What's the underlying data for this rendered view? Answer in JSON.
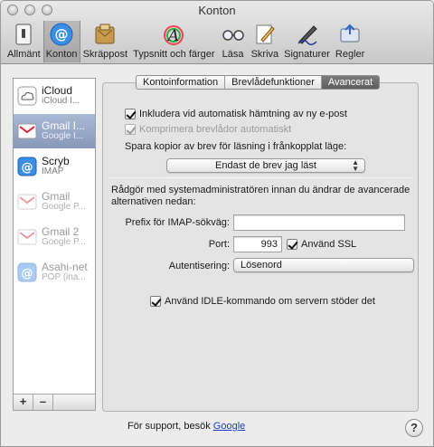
{
  "window": {
    "title": "Konton"
  },
  "toolbar": [
    {
      "label": "Allmänt",
      "icon": "switch-icon"
    },
    {
      "label": "Konton",
      "icon": "at-sign-icon",
      "selected": true
    },
    {
      "label": "Skräppost",
      "icon": "junk-mail-icon"
    },
    {
      "label": "Typsnitt och färger",
      "icon": "fonts-colors-icon"
    },
    {
      "label": "Läsa",
      "icon": "glasses-icon"
    },
    {
      "label": "Skriva",
      "icon": "pencil-icon"
    },
    {
      "label": "Signaturer",
      "icon": "signature-pen-icon"
    },
    {
      "label": "Regler",
      "icon": "rules-icon"
    }
  ],
  "accounts": [
    {
      "name": "iCloud",
      "type": "iCloud I...",
      "icon": "cloud-icon"
    },
    {
      "name": "Gmail I...",
      "type": "Google I...",
      "icon": "gmail-icon",
      "selected": true
    },
    {
      "name": "Scryb",
      "type": "IMAP",
      "icon": "at-icon"
    },
    {
      "name": "Gmail",
      "type": "Google P...",
      "icon": "gmail-icon",
      "disabled": true
    },
    {
      "name": "Gmail 2",
      "type": "Google P...",
      "icon": "gmail-icon",
      "disabled": true
    },
    {
      "name": "Asahi-net",
      "type": "POP (ina...",
      "icon": "at-icon",
      "disabled": true
    }
  ],
  "sidebar_buttons": {
    "add": "+",
    "remove": "–"
  },
  "tabs": [
    {
      "label": "Kontoinformation"
    },
    {
      "label": "Brevlådefunktioner"
    },
    {
      "label": "Avancerat",
      "active": true
    }
  ],
  "advanced": {
    "auto_fetch": {
      "label": "Inkludera vid automatisk hämtning av ny e-post",
      "checked": true
    },
    "compress": {
      "label": "Komprimera brevlådor automatiskt",
      "checked": true
    },
    "offline_label": "Spara kopior av brev för läsning i frånkopplat läge:",
    "offline_value": "Endast de brev jag läst",
    "admin_note": "Rådgör med systemadministratören innan du ändrar de avancerade alternativen nedan:",
    "imap_prefix_label": "Prefix för IMAP-sökväg:",
    "imap_prefix_value": "",
    "port_label": "Port:",
    "port_value": "993",
    "ssl": {
      "label": "Använd SSL",
      "checked": true
    },
    "auth_label": "Autentisering:",
    "auth_value": "Lösenord",
    "idle": {
      "label": "Använd IDLE-kommando om servern stöder det",
      "checked": true
    }
  },
  "footer": {
    "support_text": "För support, besök",
    "support_link": "Google",
    "help": "?"
  }
}
